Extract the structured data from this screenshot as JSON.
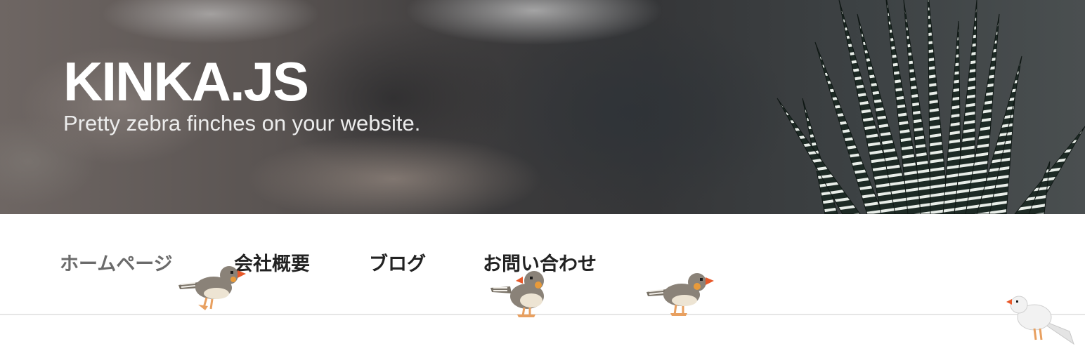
{
  "site": {
    "title": "KINKA.JS",
    "tagline": "Pretty zebra finches on your website."
  },
  "nav": {
    "items": [
      {
        "label": "ホームページ",
        "active": true
      },
      {
        "label": "会社概要",
        "active": false
      },
      {
        "label": "ブログ",
        "active": false
      },
      {
        "label": "お問い合わせ",
        "active": false
      }
    ]
  },
  "colors": {
    "title_text": "#ffffff",
    "nav_text": "#222222",
    "nav_active_text": "#6b6b6b",
    "divider": "#e6e6e6",
    "finch_beak": "#e8592a",
    "finch_cheek": "#e89a3a",
    "finch_gray": "#8a8278",
    "white_finch": "#f2f2f2"
  },
  "finches": [
    {
      "kind": "gray-zebra-finch"
    },
    {
      "kind": "gray-zebra-finch"
    },
    {
      "kind": "gray-zebra-finch"
    },
    {
      "kind": "white-finch"
    }
  ]
}
